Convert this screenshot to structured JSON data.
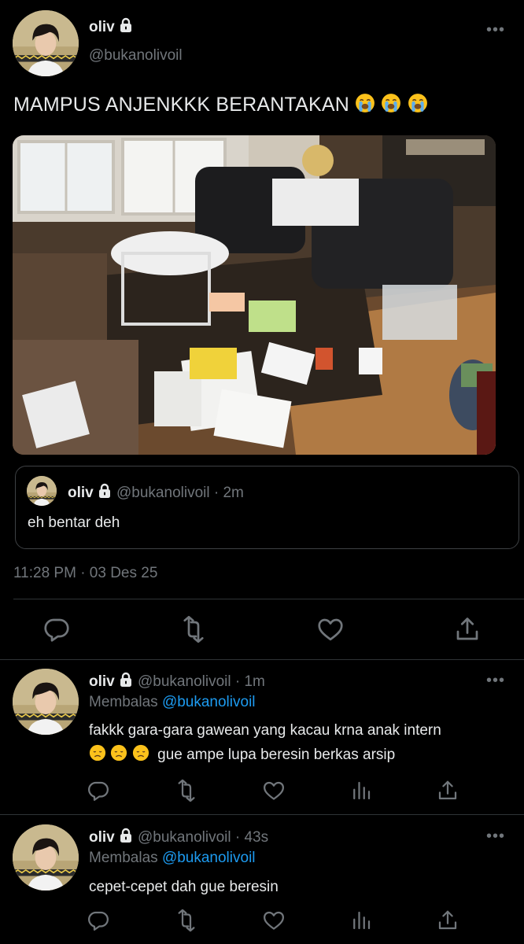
{
  "main": {
    "name": "oliv",
    "handle": "@bukanolivoil",
    "text": "MAMPUS ANJENKKK BERANTAKAN",
    "emoji": [
      "loudly-crying-face",
      "loudly-crying-face",
      "loudly-crying-face"
    ],
    "photo": "cluttered living room with papers scattered on floor",
    "quote": {
      "name": "oliv",
      "handle": "@bukanolivoil",
      "time": "· 2m",
      "text": "eh bentar deh"
    },
    "timestamp": "11:28 PM · 03 Des 25",
    "actions": [
      "reply-icon",
      "retweet-icon",
      "like-icon",
      "share-icon"
    ]
  },
  "replies": [
    {
      "name": "oliv",
      "handle": "@bukanolivoil",
      "time": "· 1m",
      "replying_label": "Membalas",
      "replying_to": "@bukanolivoil",
      "text_line1": "fakkk gara-gara gawean yang kacau krna anak intern",
      "text_line2": "gue ampe lupa beresin berkas arsip",
      "emoji": [
        "disappointed-face",
        "disappointed-face",
        "disappointed-face"
      ]
    },
    {
      "name": "oliv",
      "handle": "@bukanolivoil",
      "time": "· 43s",
      "replying_label": "Membalas",
      "replying_to": "@bukanolivoil",
      "text_line1": "cepet-cepet dah gue beresin"
    }
  ],
  "colors": {
    "background": "#000000",
    "text": "#e7e9ea",
    "muted": "#71767b",
    "link": "#1d9bf0",
    "divider": "#2f3336"
  }
}
